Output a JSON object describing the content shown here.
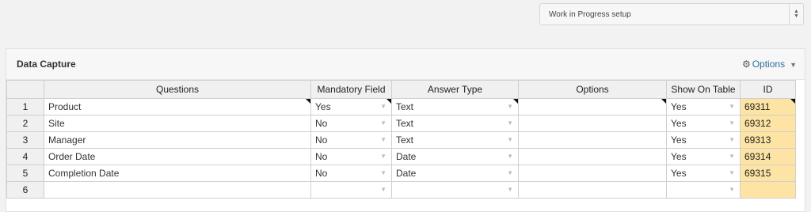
{
  "top_select": {
    "value": "Work in Progress setup"
  },
  "panel": {
    "title": "Data Capture",
    "options_label": "Options"
  },
  "columns": [
    "Questions",
    "Mandatory Field",
    "Answer Type",
    "Options",
    "Show On Table",
    "ID"
  ],
  "rows": [
    {
      "num": "1",
      "question": "Product",
      "mandatory": "Yes",
      "answer_type": "Text",
      "options": "",
      "show_on_table": "Yes",
      "id": "69311"
    },
    {
      "num": "2",
      "question": "Site",
      "mandatory": "No",
      "answer_type": "Text",
      "options": "",
      "show_on_table": "Yes",
      "id": "69312"
    },
    {
      "num": "3",
      "question": "Manager",
      "mandatory": "No",
      "answer_type": "Text",
      "options": "",
      "show_on_table": "Yes",
      "id": "69313"
    },
    {
      "num": "4",
      "question": "Order Date",
      "mandatory": "No",
      "answer_type": "Date",
      "options": "",
      "show_on_table": "Yes",
      "id": "69314"
    },
    {
      "num": "5",
      "question": "Completion Date",
      "mandatory": "No",
      "answer_type": "Date",
      "options": "",
      "show_on_table": "Yes",
      "id": "69315"
    },
    {
      "num": "6",
      "question": "",
      "mandatory": "",
      "answer_type": "",
      "options": "",
      "show_on_table": "",
      "id": ""
    }
  ]
}
